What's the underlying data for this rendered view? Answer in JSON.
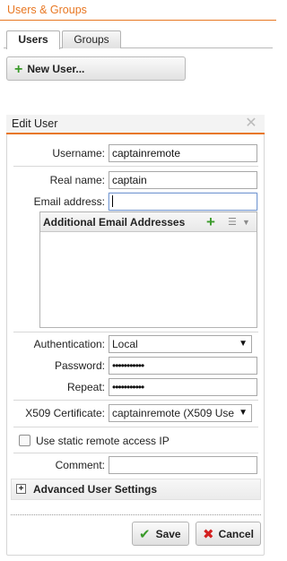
{
  "header": {
    "title": "Users & Groups"
  },
  "tabs": [
    {
      "label": "Users"
    },
    {
      "label": "Groups"
    }
  ],
  "toolbar": {
    "new_user_label": "New User..."
  },
  "panel": {
    "title": "Edit User",
    "fields": {
      "username": {
        "label": "Username:",
        "value": "captainremote"
      },
      "realname": {
        "label": "Real name:",
        "value": "captain"
      },
      "email": {
        "label": "Email address:",
        "value": ""
      },
      "additional_emails": {
        "title": "Additional Email Addresses"
      },
      "authentication": {
        "label": "Authentication:",
        "value": "Local"
      },
      "password": {
        "label": "Password:",
        "value": "•••••••••••"
      },
      "repeat": {
        "label": "Repeat:",
        "value": "•••••••••••"
      },
      "x509": {
        "label": "X509 Certificate:",
        "value": "captainremote (X509 Use"
      },
      "static_ip": {
        "label": "Use static remote access IP",
        "checked": false
      },
      "comment": {
        "label": "Comment:",
        "value": ""
      }
    },
    "advanced": {
      "label": "Advanced User Settings",
      "expanded": false
    },
    "buttons": {
      "save": "Save",
      "cancel": "Cancel"
    }
  },
  "colors": {
    "accent": "#e87722",
    "add_green": "#3a9a2a",
    "cancel_red": "#d32020"
  },
  "icons": {
    "add": "plus-icon",
    "close": "close-icon",
    "save": "checkmark-icon",
    "cancel": "x-icon",
    "list": "list-menu-icon",
    "expand": "plus-box-icon"
  }
}
